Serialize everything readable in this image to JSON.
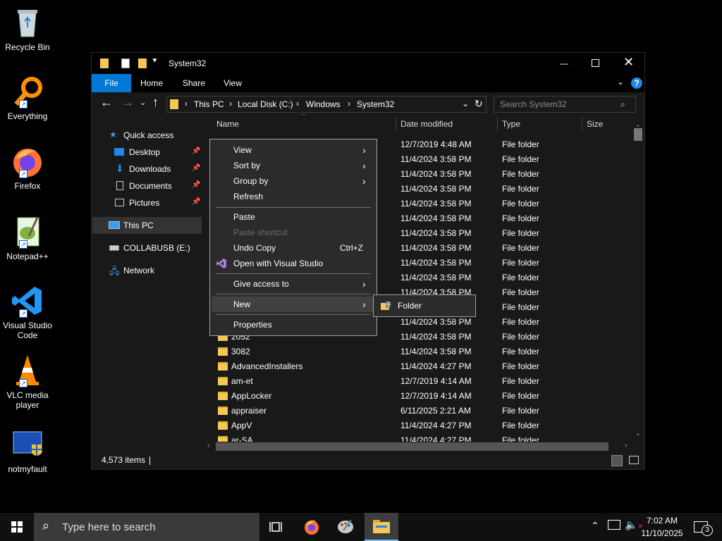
{
  "desktop": {
    "icons": [
      {
        "label": "Recycle Bin",
        "icon": "recycle-bin-icon"
      },
      {
        "label": "Everything",
        "icon": "everything-icon"
      },
      {
        "label": "Firefox",
        "icon": "firefox-icon"
      },
      {
        "label": "Notepad++",
        "icon": "notepad-plus-plus-icon"
      },
      {
        "label": "Visual Studio Code",
        "icon": "vscode-icon"
      },
      {
        "label": "VLC media player",
        "icon": "vlc-icon"
      },
      {
        "label": "notmyfault",
        "icon": "notmyfault-icon"
      }
    ]
  },
  "window": {
    "title": "System32",
    "ribbon_tabs": [
      "File",
      "Home",
      "Share",
      "View"
    ],
    "breadcrumb": [
      "This PC",
      "Local Disk (C:)",
      "Windows",
      "System32"
    ],
    "search_placeholder": "Search System32",
    "nav": {
      "quick_access": "Quick access",
      "desktop": "Desktop",
      "downloads": "Downloads",
      "documents": "Documents",
      "pictures": "Pictures",
      "this_pc": "This PC",
      "usb": "COLLABUSB (E:)",
      "network": "Network"
    },
    "columns": {
      "name": "Name",
      "date": "Date modified",
      "type": "Type",
      "size": "Size"
    },
    "rows": [
      {
        "name": "",
        "date": "12/7/2019 4:48 AM",
        "type": "File folder"
      },
      {
        "name": "",
        "date": "11/4/2024 3:58 PM",
        "type": "File folder"
      },
      {
        "name": "",
        "date": "11/4/2024 3:58 PM",
        "type": "File folder"
      },
      {
        "name": "",
        "date": "11/4/2024 3:58 PM",
        "type": "File folder"
      },
      {
        "name": "",
        "date": "11/4/2024 3:58 PM",
        "type": "File folder"
      },
      {
        "name": "",
        "date": "11/4/2024 3:58 PM",
        "type": "File folder"
      },
      {
        "name": "",
        "date": "11/4/2024 3:58 PM",
        "type": "File folder"
      },
      {
        "name": "",
        "date": "11/4/2024 3:58 PM",
        "type": "File folder"
      },
      {
        "name": "",
        "date": "11/4/2024 3:58 PM",
        "type": "File folder"
      },
      {
        "name": "",
        "date": "11/4/2024 3:58 PM",
        "type": "File folder"
      },
      {
        "name": "",
        "date": "11/4/2024 3:58 PM",
        "type": "File folder"
      },
      {
        "name": "",
        "date": "11/4/2024 3:58 PM",
        "type": "File folder"
      },
      {
        "name": "",
        "date": "11/4/2024 3:58 PM",
        "type": "File folder"
      },
      {
        "name": "2052",
        "date": "11/4/2024 3:58 PM",
        "type": "File folder"
      },
      {
        "name": "3082",
        "date": "11/4/2024 3:58 PM",
        "type": "File folder"
      },
      {
        "name": "AdvancedInstallers",
        "date": "11/4/2024 4:27 PM",
        "type": "File folder"
      },
      {
        "name": "am-et",
        "date": "12/7/2019 4:14 AM",
        "type": "File folder"
      },
      {
        "name": "AppLocker",
        "date": "12/7/2019 4:14 AM",
        "type": "File folder"
      },
      {
        "name": "appraiser",
        "date": "6/11/2025 2:21 AM",
        "type": "File folder"
      },
      {
        "name": "AppV",
        "date": "11/4/2024 4:27 PM",
        "type": "File folder"
      },
      {
        "name": "ar-SA",
        "date": "11/4/2024 4:27 PM",
        "type": "File folder"
      }
    ],
    "status": "4,573 items"
  },
  "context_menu": {
    "view": "View",
    "sort_by": "Sort by",
    "group_by": "Group by",
    "refresh": "Refresh",
    "paste": "Paste",
    "paste_shortcut": "Paste shortcut",
    "undo_copy": "Undo Copy",
    "undo_shortcut": "Ctrl+Z",
    "open_vs": "Open with Visual Studio",
    "give_access": "Give access to",
    "new": "New",
    "properties": "Properties"
  },
  "submenu": {
    "folder": "Folder"
  },
  "taskbar": {
    "search_placeholder": "Type here to search",
    "time": "7:02 AM",
    "date": "11/10/2025",
    "notifications": "3"
  },
  "colors": {
    "accent": "#0078d7",
    "folder": "#f6c757"
  }
}
